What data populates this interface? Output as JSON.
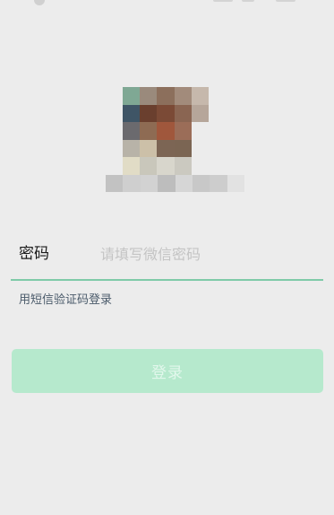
{
  "login_form": {
    "password_label": "密码",
    "password_placeholder": "请填写微信密码",
    "password_value": "",
    "sms_login_link": "用短信验证码登录",
    "login_button": "登录"
  },
  "colors": {
    "background": "#ececec",
    "accent": "#7fcaa8",
    "button_disabled_bg": "#b6e9cd",
    "button_disabled_text": "#e2f7ec"
  }
}
